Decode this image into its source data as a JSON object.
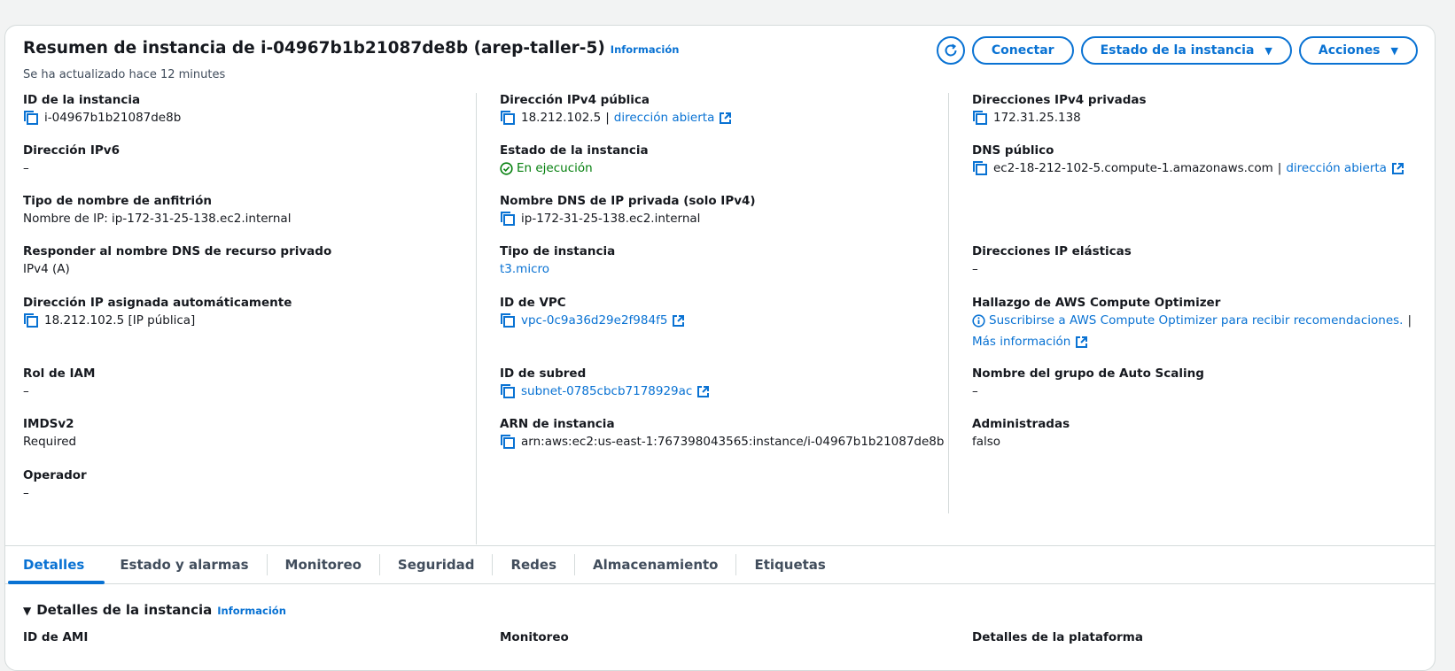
{
  "header": {
    "title": "Resumen de instancia de i-04967b1b21087de8b (arep-taller-5)",
    "info_label": "Información",
    "updated": "Se ha actualizado hace 12 minutes",
    "buttons": {
      "connect": "Conectar",
      "instance_state": "Estado de la instancia",
      "actions": "Acciones"
    }
  },
  "col1": {
    "instance_id": {
      "label": "ID de la instancia",
      "value": "i-04967b1b21087de8b"
    },
    "ipv6": {
      "label": "Dirección IPv6",
      "value": "–"
    },
    "hostname_type": {
      "label": "Tipo de nombre de anfitrión",
      "value": "Nombre de IP: ip-172-31-25-138.ec2.internal"
    },
    "dns_resource": {
      "label": "Responder al nombre DNS de recurso privado",
      "value": "IPv4 (A)"
    },
    "auto_ip": {
      "label": "Dirección IP asignada automáticamente",
      "value": "18.212.102.5 [IP pública]"
    },
    "iam_role": {
      "label": "Rol de IAM",
      "value": "–"
    },
    "imdsv2": {
      "label": "IMDSv2",
      "value": "Required"
    },
    "operator": {
      "label": "Operador",
      "value": "–"
    }
  },
  "col2": {
    "public_ipv4": {
      "label": "Dirección IPv4 pública",
      "value": "18.212.102.5",
      "sep": "|",
      "link": "dirección abierta"
    },
    "state": {
      "label": "Estado de la instancia",
      "value": "En ejecución"
    },
    "private_dns": {
      "label": "Nombre DNS de IP privada (solo IPv4)",
      "value": "ip-172-31-25-138.ec2.internal"
    },
    "instance_type": {
      "label": "Tipo de instancia",
      "value": "t3.micro"
    },
    "vpc_id": {
      "label": "ID de VPC",
      "value": "vpc-0c9a36d29e2f984f5"
    },
    "subnet_id": {
      "label": "ID de subred",
      "value": "subnet-0785cbcb7178929ac"
    },
    "arn": {
      "label": "ARN de instancia",
      "value": "arn:aws:ec2:us-east-1:767398043565:instance/i-04967b1b21087de8b"
    }
  },
  "col3": {
    "private_ipv4": {
      "label": "Direcciones IPv4 privadas",
      "value": "172.31.25.138"
    },
    "public_dns": {
      "label": "DNS público",
      "value": "ec2-18-212-102-5.compute-1.amazonaws.com",
      "sep": "|",
      "link": "dirección abierta"
    },
    "elastic_ip": {
      "label": "Direcciones IP elásticas",
      "value": "–"
    },
    "optimizer": {
      "label": "Hallazgo de AWS Compute Optimizer",
      "value": "Suscribirse a AWS Compute Optimizer para recibir recomendaciones.",
      "sep": "|",
      "more": "Más información"
    },
    "asg": {
      "label": "Nombre del grupo de Auto Scaling",
      "value": "–"
    },
    "managed": {
      "label": "Administradas",
      "value": "falso"
    }
  },
  "tabs": [
    "Detalles",
    "Estado y alarmas",
    "Monitoreo",
    "Seguridad",
    "Redes",
    "Almacenamiento",
    "Etiquetas"
  ],
  "details_section": {
    "title": "Detalles de la instancia",
    "info_label": "Información",
    "col_labels": [
      "ID de AMI",
      "Monitoreo",
      "Detalles de la plataforma"
    ]
  },
  "colors": {
    "accent": "#0972d3",
    "success": "#037f0c",
    "border": "#d5dbdb"
  }
}
